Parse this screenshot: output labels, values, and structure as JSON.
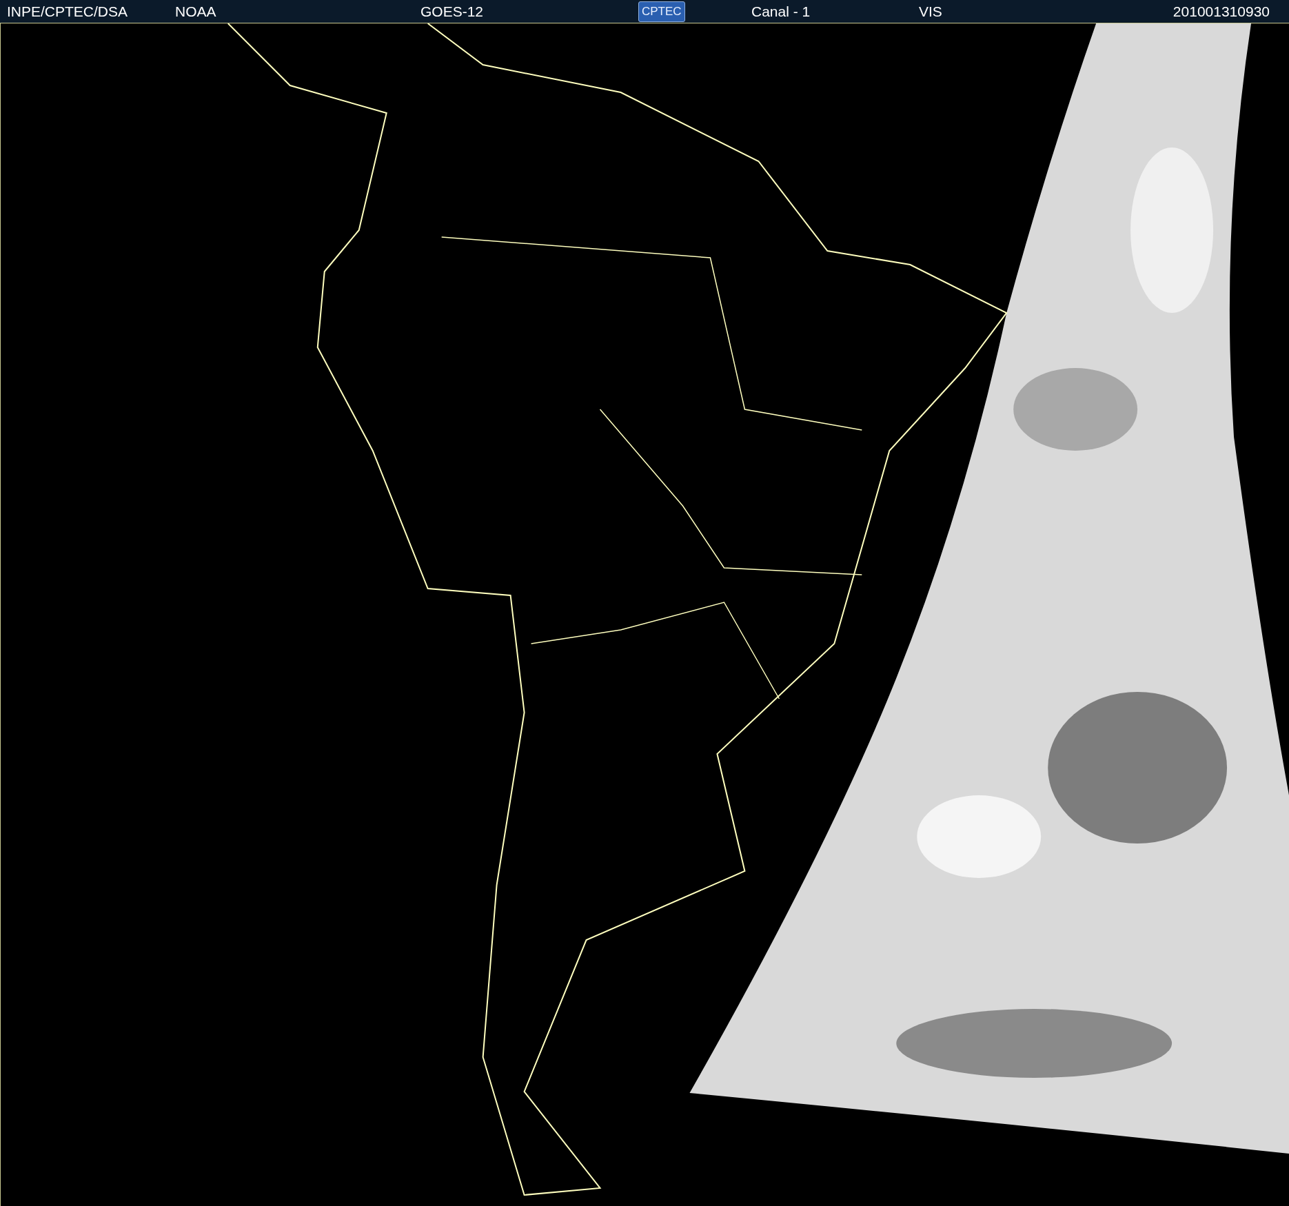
{
  "header": {
    "items": [
      {
        "kind": "text",
        "text": "INPE/CPTEC/DSA"
      },
      {
        "kind": "text",
        "text": "NOAA"
      },
      {
        "kind": "text",
        "text": "GOES-12"
      },
      {
        "kind": "logo",
        "text": "CPTEC"
      },
      {
        "kind": "text",
        "text": "Canal - 1"
      },
      {
        "kind": "text",
        "text": "VIS"
      },
      {
        "kind": "text",
        "text": "201001310930"
      }
    ]
  }
}
